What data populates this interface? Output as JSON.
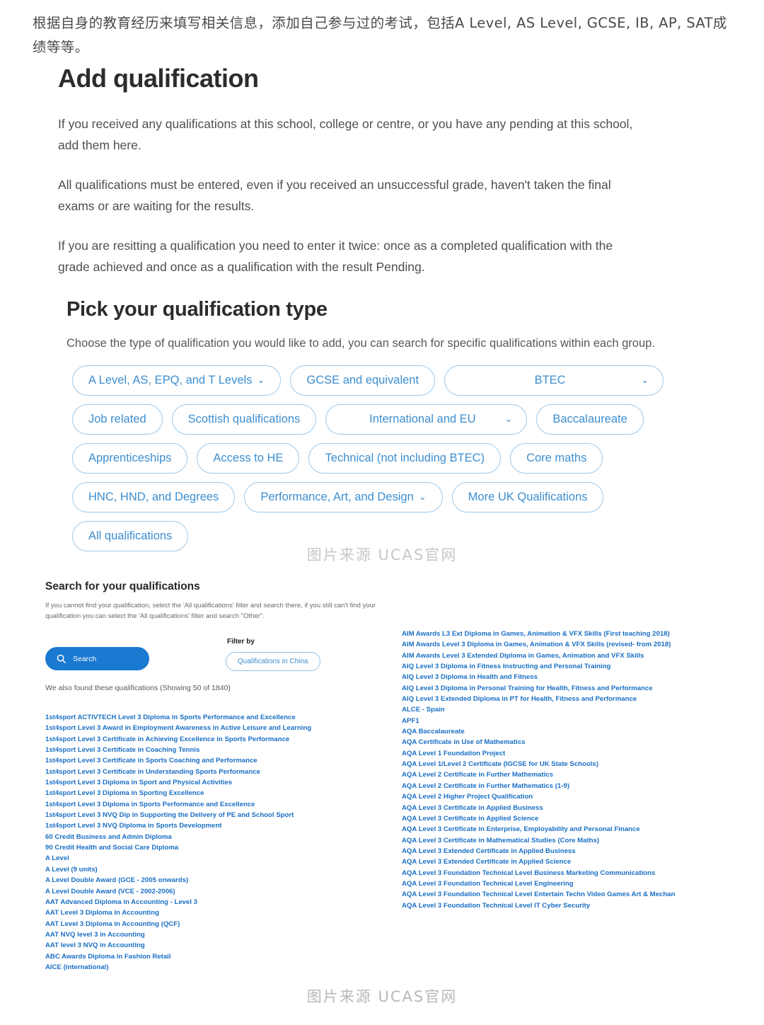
{
  "intro_note": "根据自身的教育经历来填写相关信息，添加自己参与过的考试，包括A Level, AS Level, GCSE, IB, AP, SAT成绩等等。",
  "watermark": {
    "middle": "图片来源 UCAS官网",
    "bottom": "图片来源 UCAS官网"
  },
  "page": {
    "title": "Add qualification",
    "paragraphs": [
      "If you received any qualifications at this school, college or centre, or you have any pending at this school, add them here.",
      "All qualifications must be entered, even if you received an unsuccessful grade, haven't taken the final exams or are waiting for the results.",
      "If you are resitting a qualification you need to enter it twice: once as a completed qualification with the grade achieved and once as a qualification with the result Pending."
    ]
  },
  "pick_type": {
    "heading": "Pick your qualification type",
    "description": "Choose the type of qualification you would like to add, you can search for specific qualifications within each group.",
    "chevron_glyph": "⌄",
    "rows": [
      [
        {
          "label": "A Level, AS, EPQ, and T Levels",
          "dropdown": true,
          "wide": false
        },
        {
          "label": "GCSE and equivalent",
          "dropdown": false,
          "wide": false
        },
        {
          "label": "BTEC",
          "dropdown": true,
          "wide": true,
          "width_class": "w-btec"
        }
      ],
      [
        {
          "label": "Job related",
          "dropdown": false,
          "wide": false
        },
        {
          "label": "Scottish qualifications",
          "dropdown": false,
          "wide": false
        },
        {
          "label": "International and EU",
          "dropdown": true,
          "wide": true,
          "width_class": "w-intl"
        },
        {
          "label": "Baccalaureate",
          "dropdown": false,
          "wide": false
        }
      ],
      [
        {
          "label": "Apprenticeships",
          "dropdown": false,
          "wide": false
        },
        {
          "label": "Access to HE",
          "dropdown": false,
          "wide": false
        },
        {
          "label": "Technical (not including BTEC)",
          "dropdown": false,
          "wide": false
        },
        {
          "label": "Core maths",
          "dropdown": false,
          "wide": false
        }
      ],
      [
        {
          "label": "HNC, HND, and Degrees",
          "dropdown": false,
          "wide": false
        },
        {
          "label": "Performance, Art, and Design",
          "dropdown": true,
          "wide": false
        },
        {
          "label": "More UK Qualifications",
          "dropdown": false,
          "wide": false
        }
      ],
      [
        {
          "label": "All qualifications",
          "dropdown": false,
          "wide": false
        }
      ]
    ]
  },
  "search": {
    "title": "Search for your qualifications",
    "help": "If you cannot find your qualification, select the 'All qualifications' filter and search there, if you still can't find your qualification you can select the 'All qualifications' filter and search \"Other\".",
    "button_label": "Search",
    "search_icon": "magnifier-icon",
    "filter_label": "Filter by",
    "filter_chip": "Qualifications in China",
    "found_text": "We also found these qualifications (Showing 50 of 1840)"
  },
  "results": {
    "left_column": [
      "1st4sport ACTIVTECH Level 3 Diploma in Sports Performance and Excellence",
      "1st4sport Level 3 Award in Employment Awareness in Active Leisure and Learning",
      "1st4sport Level 3 Certificate in Achieving Excellence in Sports Performance",
      "1st4sport Level 3 Certificate in Coaching Tennis",
      "1st4sport Level 3 Certificate in Sports Coaching and Performance",
      "1st4sport Level 3 Certificate in Understanding Sports Performance",
      "1st4sport Level 3 Diploma in Sport and Physical Activities",
      "1st4sport Level 3 Diploma in Sporting Excellence",
      "1st4sport Level 3 Diploma in Sports Performance and Excellence",
      "1st4sport Level 3 NVQ Dip in Supporting the Delivery of PE and School Sport",
      "1st4sport Level 3 NVQ Diploma in Sports Development",
      "60 Credit Business and Admin Diploma",
      "90 Credit Health and Social Care Diploma",
      "A Level",
      "A Level (9 units)",
      "A Level Double Award (GCE - 2005 onwards)",
      "A Level Double Award (VCE - 2002-2006)",
      "AAT Advanced Diploma in Accounting - Level 3",
      "AAT Level 3 Diploma in Accounting",
      "AAT Level 3 Diploma in Accounting (QCF)",
      "AAT NVQ level 3 in Accounting",
      "AAT level 3 NVQ in Accounting",
      "ABC Awards Diploma in Fashion Retail",
      "AICE (international)"
    ],
    "right_column": [
      "AIM Awards L3 Ext Diploma in Games, Animation & VFX Skills (First teaching 2018)",
      "AIM Awards Level 3 Diploma in Games, Animation & VFX Skills (revised- from 2018)",
      "AIM Awards Level 3 Extended Diploma in Games, Animation and VFX Skills",
      "AIQ Level 3 Diploma in Fitness Instructing and Personal Training",
      "AIQ Level 3 Diploma in Health and Fitness",
      "AIQ Level 3 Diploma in Personal Training for Health, Fitness and Performance",
      "AIQ Level 3 Extended Diploma in PT for Health, Fitness and Performance",
      "ALCE - Spain",
      "APF1",
      "AQA Baccalaureate",
      "AQA Certificate in Use of Mathematics",
      "AQA Level 1 Foundation Project",
      "AQA Level 1/Level 2 Certificate (IGCSE for UK State Schools)",
      "AQA Level 2 Certificate in Further Mathematics",
      "AQA Level 2 Certificate in Further Mathematics (1-9)",
      "AQA Level 2 Higher Project Qualification",
      "AQA Level 3 Certificate in Applied Business",
      "AQA Level 3 Certificate in Applied Science",
      "AQA Level 3 Certificate in Enterprise, Employability and Personal Finance",
      "AQA Level 3 Certificate in Mathematical Studies (Core Maths)",
      "AQA Level 3 Extended Certificate in Applied Business",
      "AQA Level 3 Extended Certificate in Applied Science",
      "AQA Level 3 Foundation Technical Level Business Marketing Communications",
      "AQA Level 3 Foundation Technical Level Engineering",
      "AQA Level 3 Foundation Technical Level Entertain Techn Video Games Art & Mechan",
      "AQA Level 3 Foundation Technical Level IT Cyber Security"
    ]
  },
  "colors": {
    "link_blue": "#1a6fc4",
    "pill_border": "#9ec8e8",
    "pill_text": "#3d8ecf",
    "primary_button": "#1a79d1",
    "watermark_grey": "#c7c7c7"
  }
}
